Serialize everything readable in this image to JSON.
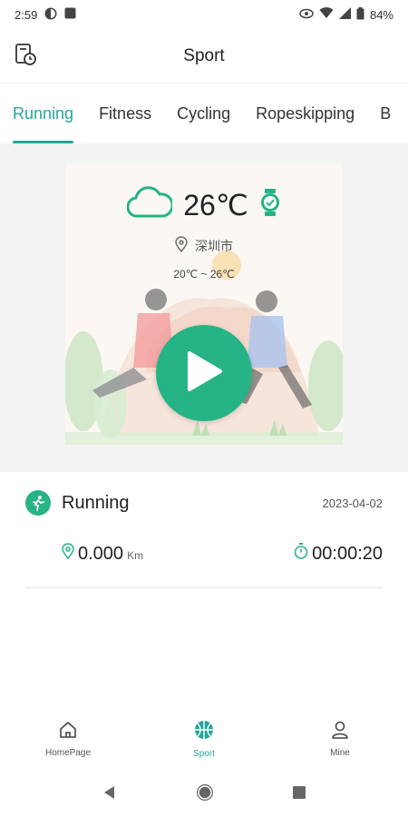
{
  "status_bar": {
    "time": "2:59",
    "battery": "84%",
    "icons": [
      "app-notification-icon",
      "square-notification-icon",
      "eye-icon",
      "wifi-icon",
      "signal-icon",
      "battery-icon"
    ]
  },
  "header": {
    "title": "Sport",
    "left_icon": "history-clock-icon"
  },
  "tabs": [
    {
      "label": "Running",
      "active": true
    },
    {
      "label": "Fitness",
      "active": false
    },
    {
      "label": "Cycling",
      "active": false
    },
    {
      "label": "Ropeskipping",
      "active": false
    },
    {
      "label": "B",
      "active": false
    }
  ],
  "weather": {
    "temperature": "26℃",
    "city": "深圳市",
    "range": "20℃ ~ 26℃",
    "icon": "cloud-icon",
    "watch_icon": "watch-check-icon",
    "location_icon": "location-pin-icon"
  },
  "start_button": {
    "icon": "play-icon"
  },
  "record": {
    "title": "Running",
    "date": "2023-04-02",
    "distance": "0.000",
    "distance_unit": "Km",
    "duration": "00:00:20",
    "icon": "runner-icon"
  },
  "bottom_nav": [
    {
      "label": "HomePage",
      "icon": "home-icon",
      "active": false
    },
    {
      "label": "Sport",
      "icon": "basketball-icon",
      "active": true
    },
    {
      "label": "Mine",
      "icon": "person-icon",
      "active": false
    }
  ],
  "colors": {
    "accent": "#26a69a",
    "play_button": "#26b386",
    "card_bg": "#fbf7f3"
  }
}
